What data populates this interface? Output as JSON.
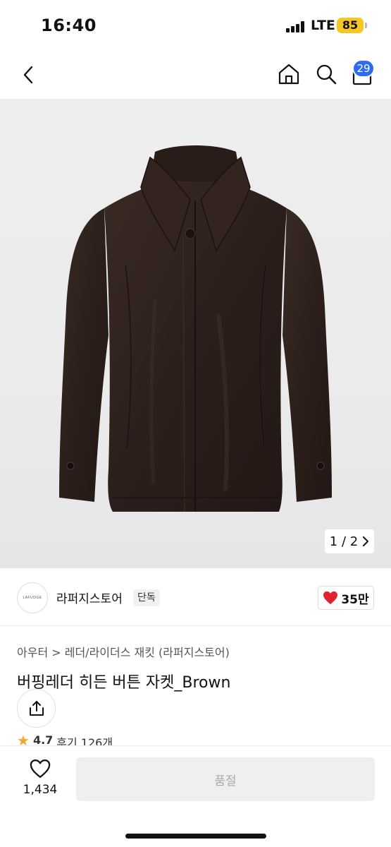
{
  "status_bar": {
    "time": "16:40",
    "network": "LTE",
    "battery": "85"
  },
  "nav": {
    "back_icon": "chevron-left-icon",
    "home_icon": "home-icon",
    "search_icon": "search-icon",
    "cart_icon": "bag-icon",
    "cart_count": "29"
  },
  "gallery": {
    "pager": "1 / 2",
    "pager_icon": "chevron-right-icon"
  },
  "store": {
    "logo_text": "LAFUDGE",
    "name": "라퍼지스토어",
    "badge": "단독",
    "likes": "35만",
    "like_icon": "heart-filled-icon"
  },
  "product": {
    "breadcrumb": "아우터 > 레더/라이더스 재킷 (라퍼지스토어)",
    "title": "버핑레더 히든 버튼 자켓_Brown",
    "share_icon": "share-icon",
    "rating": {
      "score": "4.7",
      "reviews": "후기 126개"
    }
  },
  "bottom_bar": {
    "wish_count": "1,434",
    "wish_icon": "heart-outline-icon",
    "buy_label": "품절"
  },
  "colors": {
    "accent_blue": "#2f6bf0",
    "battery_yellow": "#f6c623",
    "heart_red": "#e0242f",
    "jacket_brown": "#2e211d"
  }
}
